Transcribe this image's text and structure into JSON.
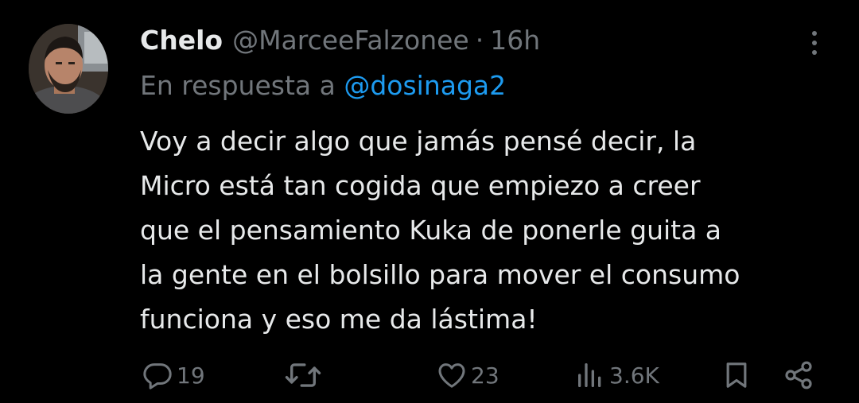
{
  "tweet": {
    "author": {
      "display_name": "Chelo",
      "handle": "@MarceeFalzonee",
      "separator": "·",
      "timestamp": "16h"
    },
    "reply_to": {
      "prefix": "En respuesta a",
      "handle": "@dosinaga2"
    },
    "text_lines": [
      "Voy a decir algo que jamás pensé decir, la",
      "Micro está tan cogida que empiezo a creer",
      "que el pensamiento Kuka de ponerle guita a",
      "la gente en el bolsillo para mover el consumo",
      "funciona y eso me da lástima!"
    ]
  },
  "actions": {
    "replies": "19",
    "retweets": "",
    "likes": "23",
    "views": "3.6K"
  },
  "icons": {
    "reply": "reply-icon",
    "retweet": "retweet-icon",
    "like": "heart-icon",
    "views": "views-icon",
    "bookmark": "bookmark-icon",
    "share": "share-icon",
    "more": "more-vertical-icon"
  },
  "colors": {
    "background": "#000000",
    "primary_text": "#e7e9ea",
    "secondary_text": "#71767b",
    "link": "#1d9bf0"
  }
}
